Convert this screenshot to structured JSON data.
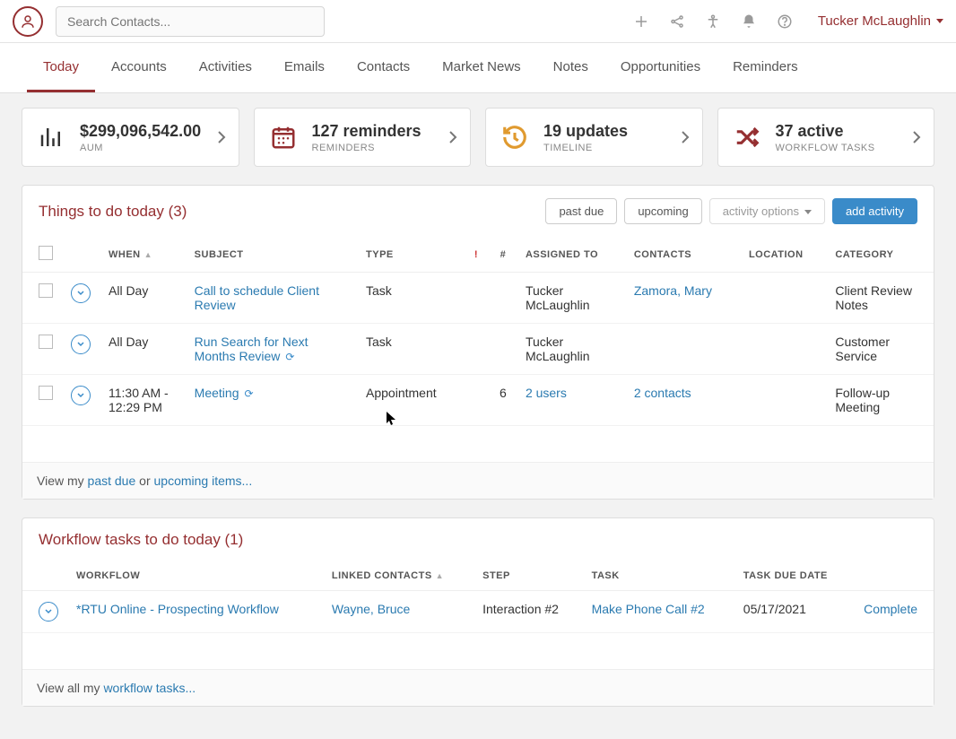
{
  "search": {
    "placeholder": "Search Contacts..."
  },
  "user": {
    "name": "Tucker McLaughlin"
  },
  "tabs": [
    "Today",
    "Accounts",
    "Activities",
    "Emails",
    "Contacts",
    "Market News",
    "Notes",
    "Opportunities",
    "Reminders"
  ],
  "activeTab": "Today",
  "cards": {
    "aum": {
      "title": "$299,096,542.00",
      "sub": "AUM"
    },
    "reminders": {
      "title": "127 reminders",
      "sub": "REMINDERS"
    },
    "timeline": {
      "title": "19 updates",
      "sub": "TIMELINE"
    },
    "workflow": {
      "title": "37 active",
      "sub": "WORKFLOW TASKS"
    }
  },
  "todo": {
    "title": "Things to do today (3)",
    "filters": {
      "past_due": "past due",
      "upcoming": "upcoming",
      "options": "activity options",
      "add": "add activity"
    },
    "columns": {
      "when": "WHEN",
      "subject": "SUBJECT",
      "type": "TYPE",
      "priority": "!",
      "count": "#",
      "assigned": "ASSIGNED TO",
      "contacts": "CONTACTS",
      "location": "LOCATION",
      "category": "CATEGORY"
    },
    "rows": [
      {
        "when": "All Day",
        "subject": "Call to schedule Client Review",
        "type": "Task",
        "count": "",
        "assigned": "Tucker McLaughlin",
        "contacts": "Zamora, Mary",
        "contacts_link": true,
        "category": "Client Review Notes",
        "refresh": false
      },
      {
        "when": "All Day",
        "subject": "Run Search for Next Months Review",
        "type": "Task",
        "count": "",
        "assigned": "Tucker McLaughlin",
        "contacts": "",
        "contacts_link": false,
        "category": "Customer Service",
        "refresh": true
      },
      {
        "when": "11:30 AM - 12:29 PM",
        "subject": "Meeting",
        "type": "Appointment",
        "count": "6",
        "assigned": "2 users",
        "assigned_link": true,
        "contacts": "2 contacts",
        "contacts_link": true,
        "category": "Follow-up Meeting",
        "refresh": true
      }
    ],
    "footer": {
      "prefix": "View my ",
      "past_due": "past due",
      "or": " or ",
      "upcoming": "upcoming items..."
    }
  },
  "workflow_panel": {
    "title": "Workflow tasks to do today (1)",
    "columns": {
      "workflow": "WORKFLOW",
      "linked": "LINKED CONTACTS",
      "step": "STEP",
      "task": "TASK",
      "due": "TASK DUE DATE"
    },
    "rows": [
      {
        "workflow": "*RTU Online - Prospecting Workflow",
        "linked": "Wayne, Bruce",
        "step": "Interaction #2",
        "task": "Make Phone Call #2",
        "due": "05/17/2021",
        "action": "Complete"
      }
    ],
    "footer": {
      "prefix": "View all my ",
      "link": "workflow tasks..."
    }
  }
}
